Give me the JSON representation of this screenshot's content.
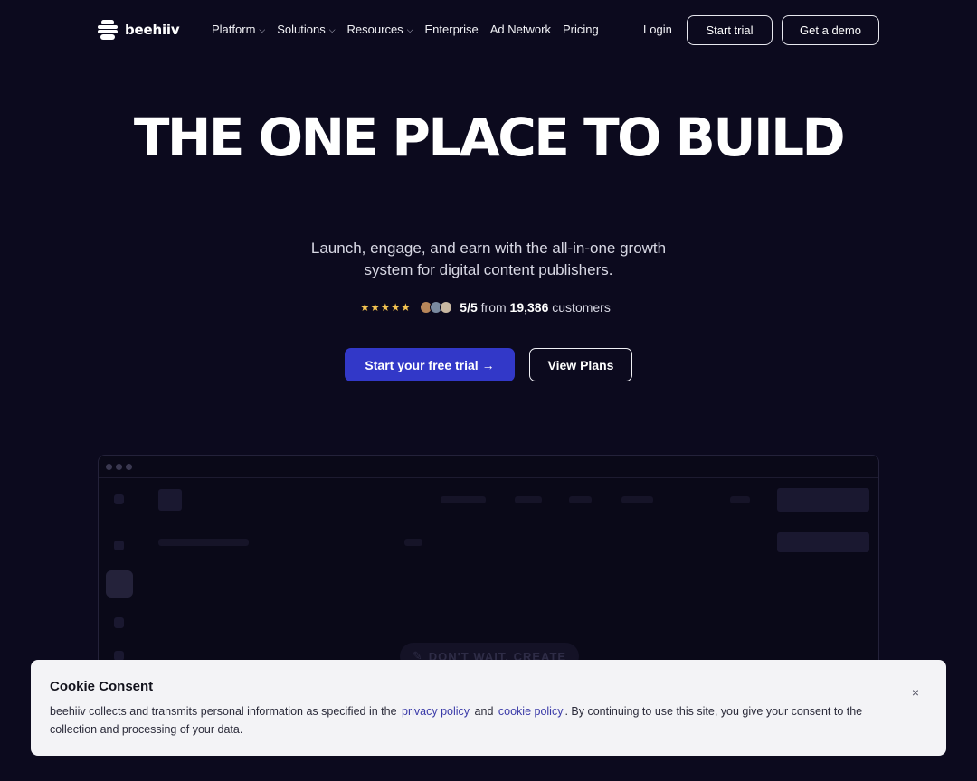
{
  "nav": {
    "brand": "beehiiv",
    "links": [
      {
        "label": "Platform",
        "dropdown": true
      },
      {
        "label": "Solutions",
        "dropdown": true
      },
      {
        "label": "Resources",
        "dropdown": true
      },
      {
        "label": "Enterprise",
        "dropdown": false
      },
      {
        "label": "Ad Network",
        "dropdown": false
      },
      {
        "label": "Pricing",
        "dropdown": false
      }
    ],
    "login": "Login",
    "start_trial": "Start trial",
    "get_demo": "Get a demo"
  },
  "hero": {
    "title": "THE ONE PLACE TO BUILD",
    "subtitle": "Launch, engage, and earn with the all-in-one growth system for digital content publishers.",
    "rating": {
      "stars": "★★★★★",
      "score": "5/5",
      "from": "from",
      "count": "19,386",
      "suffix": "customers"
    },
    "cta_primary": "Start your free trial →",
    "cta_secondary": "View Plans"
  },
  "preview": {
    "pill_text": "DON'T WAIT. CREATE"
  },
  "cookie": {
    "title": "Cookie Consent",
    "text_1": "beehiiv collects and transmits personal information as specified in the",
    "privacy_link": "privacy policy",
    "and": "and",
    "cookie_link": "cookie policy",
    "text_2": ". By continuing to use this site, you give your consent to the collection and processing of your data.",
    "close": "×"
  },
  "colors": {
    "background": "#0c0a1e",
    "accent": "#3238c8",
    "star": "#f5c451",
    "link": "#3a3aa8"
  },
  "icons": [
    "beehiiv-logo-icon",
    "chevron-down-icon",
    "star-icon",
    "arrow-right-icon",
    "close-icon",
    "pencil-icon"
  ]
}
